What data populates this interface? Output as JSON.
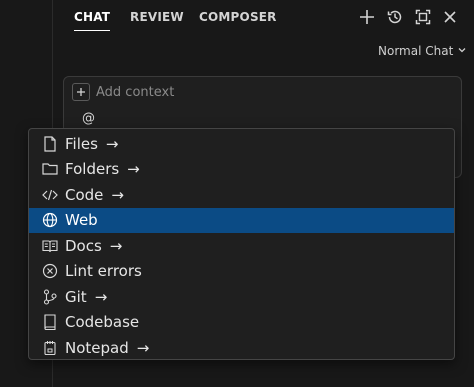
{
  "tabs": [
    {
      "label": "CHAT",
      "active": true
    },
    {
      "label": "REVIEW",
      "active": false
    },
    {
      "label": "COMPOSER",
      "active": false
    }
  ],
  "header_icons": [
    "plus-icon",
    "history-icon",
    "expand-icon",
    "close-icon"
  ],
  "mode": {
    "label": "Normal Chat",
    "caret": "chevron-down-icon"
  },
  "composer": {
    "add_context_label": "Add context",
    "input_value": "@"
  },
  "mention_menu": {
    "items": [
      {
        "label": "Files",
        "icon": "file-icon",
        "has_arrow": true,
        "arrow": "→"
      },
      {
        "label": "Folders",
        "icon": "folder-icon",
        "has_arrow": true,
        "arrow": "→"
      },
      {
        "label": "Code",
        "icon": "code-icon",
        "has_arrow": true,
        "arrow": "→"
      },
      {
        "label": "Web",
        "icon": "globe-icon",
        "has_arrow": false,
        "selected": true
      },
      {
        "label": "Docs",
        "icon": "book-icon",
        "has_arrow": true,
        "arrow": "→"
      },
      {
        "label": "Lint errors",
        "icon": "error-circle-icon",
        "has_arrow": false
      },
      {
        "label": "Git",
        "icon": "git-icon",
        "has_arrow": true,
        "arrow": "→"
      },
      {
        "label": "Codebase",
        "icon": "codebase-icon",
        "has_arrow": false
      },
      {
        "label": "Notepad",
        "icon": "notepad-icon",
        "has_arrow": true,
        "arrow": "→"
      }
    ]
  },
  "colors": {
    "background": "#181818",
    "selected": "#0b4b85",
    "menu_bg": "#1f1f1f"
  }
}
